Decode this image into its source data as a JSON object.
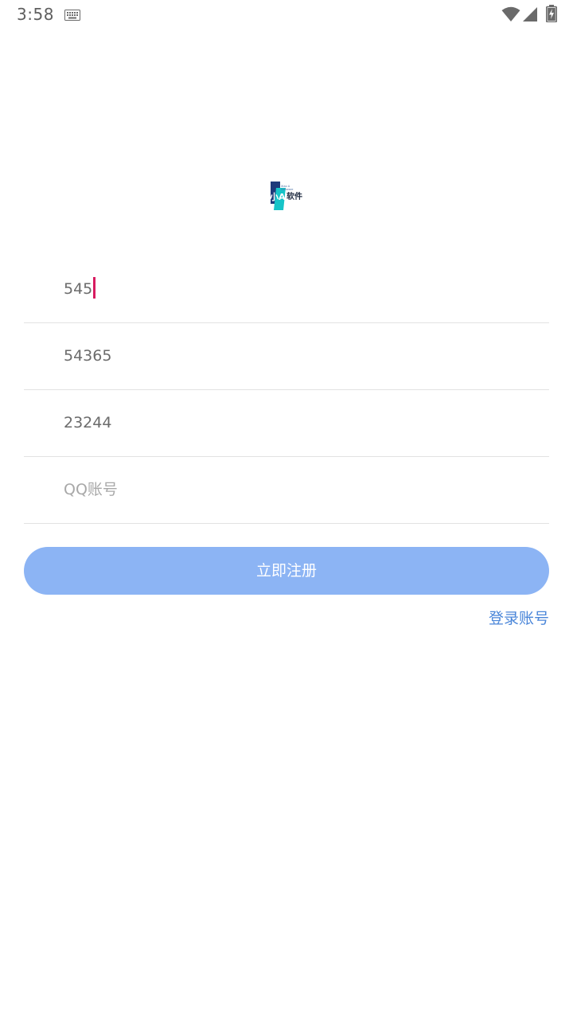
{
  "status_bar": {
    "time": "3:58",
    "icons": [
      "keyboard-icon",
      "wifi-icon",
      "signal-icon",
      "battery-charging-icon"
    ]
  },
  "logo": {
    "icon": "xiao-a-software-logo",
    "text": "小A软件",
    "colors": {
      "dark": "#1e3a7a",
      "accent": "#16c4c8"
    }
  },
  "form": {
    "fields": [
      {
        "value": "545",
        "placeholder": "",
        "focused": true
      },
      {
        "value": "54365",
        "placeholder": ""
      },
      {
        "value": "23244",
        "placeholder": ""
      },
      {
        "value": "",
        "placeholder": "QQ账号"
      }
    ],
    "caret_color": "#d81b60"
  },
  "actions": {
    "register_label": "立即注册",
    "register_color": "#8cb4f4",
    "login_label": "登录账号",
    "login_color": "#4a86d9"
  }
}
